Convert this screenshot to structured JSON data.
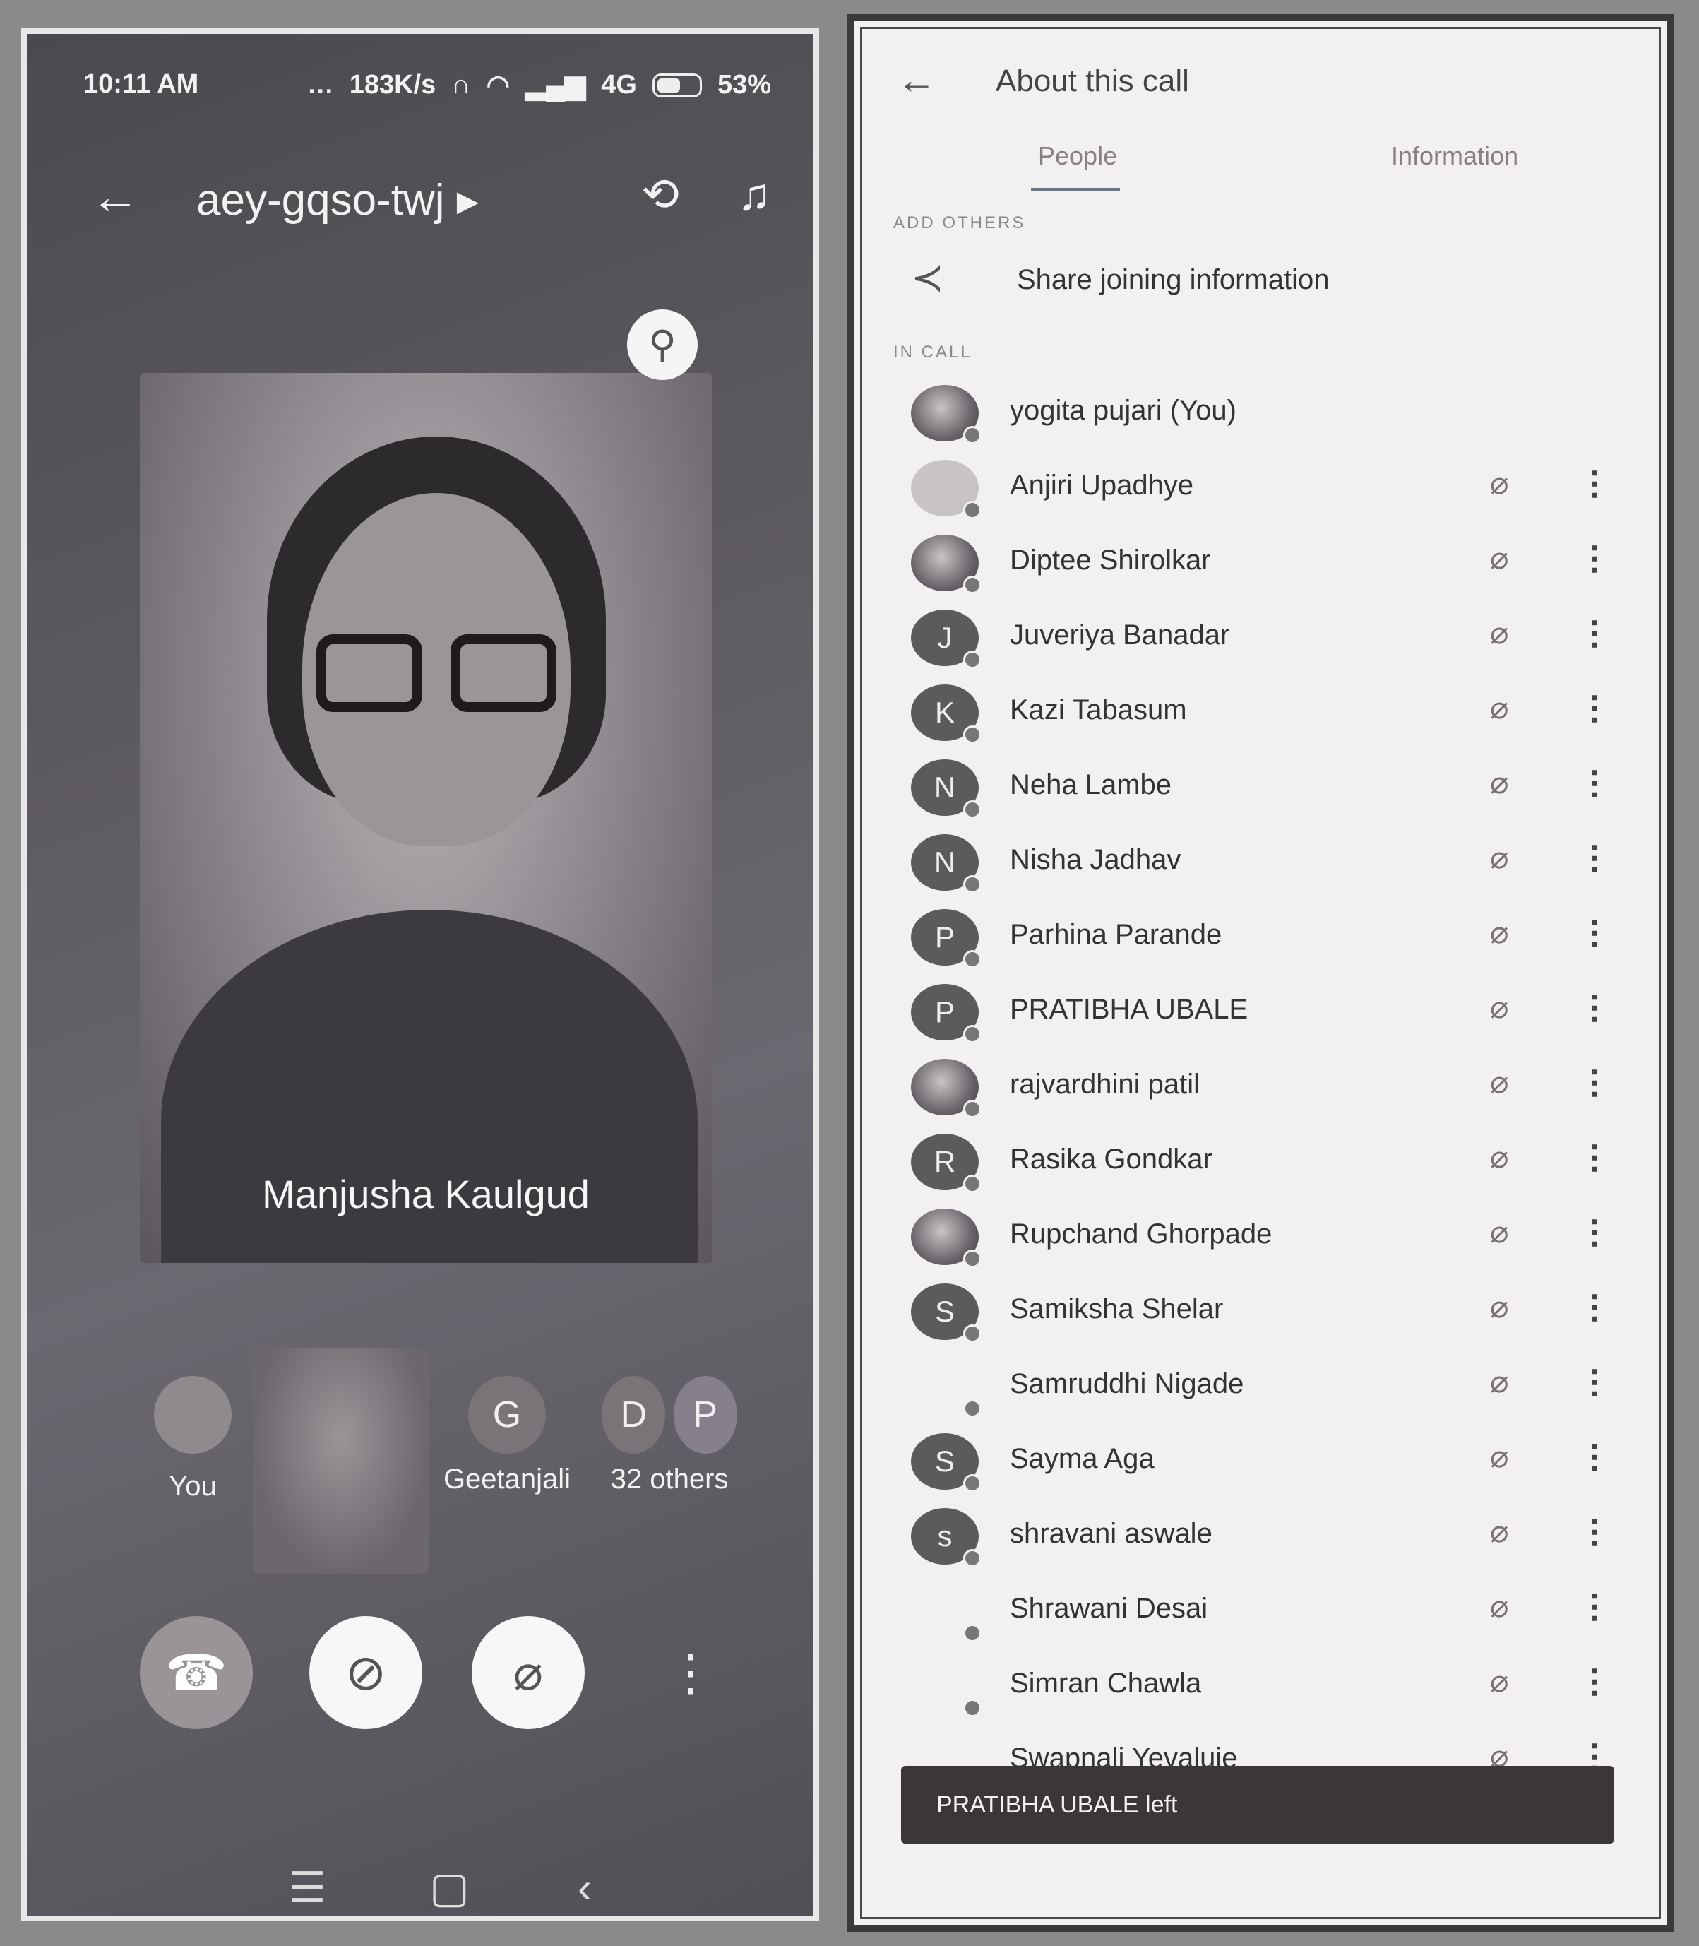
{
  "status_bar": {
    "time": "10:11 AM",
    "data_speed": "183K/s",
    "network": "4G",
    "battery": "53%"
  },
  "meeting": {
    "code": "aey-gqso-twj",
    "main_tile_name": "Manjusha Kaulgud"
  },
  "strip": {
    "you_label": "You",
    "geetanjali_label": "Geetanjali",
    "geetanjali_initial": "G",
    "others_label": "32 others",
    "others_initials": [
      "D",
      "P"
    ]
  },
  "icons": {
    "back": "back-arrow-icon",
    "flip_camera": "flip-camera-icon",
    "headphones": "headphones-icon",
    "pin": "pin-icon",
    "end_call": "end-call-icon",
    "camera_off": "camera-off-icon",
    "mic_off": "mic-off-icon",
    "more": "more-vertical-icon",
    "share": "share-icon"
  },
  "about_call": {
    "title": "About this call",
    "tabs": [
      "People",
      "Information"
    ],
    "active_tab": "People",
    "add_others_label": "ADD OTHERS",
    "share_label": "Share joining information",
    "in_call_label": "IN CALL",
    "participants": [
      {
        "name": "yogita pujari (You)",
        "initial": "",
        "avatar": "photo"
      },
      {
        "name": "Anjiri Upadhye",
        "initial": "",
        "avatar": "light"
      },
      {
        "name": "Diptee Shirolkar",
        "initial": "",
        "avatar": "photo"
      },
      {
        "name": "Juveriya Banadar",
        "initial": "J",
        "avatar": "letter"
      },
      {
        "name": "Kazi Tabasum",
        "initial": "K",
        "avatar": "letter"
      },
      {
        "name": "Neha Lambe",
        "initial": "N",
        "avatar": "letter"
      },
      {
        "name": "Nisha Jadhav",
        "initial": "N",
        "avatar": "letter"
      },
      {
        "name": "Parhina Parande",
        "initial": "P",
        "avatar": "letter"
      },
      {
        "name": "PRATIBHA UBALE",
        "initial": "P",
        "avatar": "letter"
      },
      {
        "name": "rajvardhini patil",
        "initial": "",
        "avatar": "photo"
      },
      {
        "name": "Rasika Gondkar",
        "initial": "R",
        "avatar": "letter"
      },
      {
        "name": "Rupchand Ghorpade",
        "initial": "",
        "avatar": "photo"
      },
      {
        "name": "Samiksha Shelar",
        "initial": "S",
        "avatar": "letter"
      },
      {
        "name": "Samruddhi Nigade",
        "initial": "",
        "avatar": "none"
      },
      {
        "name": "Sayma Aga",
        "initial": "S",
        "avatar": "letter"
      },
      {
        "name": "shravani aswale",
        "initial": "s",
        "avatar": "letter"
      },
      {
        "name": "Shrawani Desai",
        "initial": "",
        "avatar": "none"
      },
      {
        "name": "Simran Chawla",
        "initial": "",
        "avatar": "none"
      },
      {
        "name": "Swapnali Yevaluje",
        "initial": "",
        "avatar": "none"
      }
    ],
    "toast": "PRATIBHA UBALE left"
  }
}
